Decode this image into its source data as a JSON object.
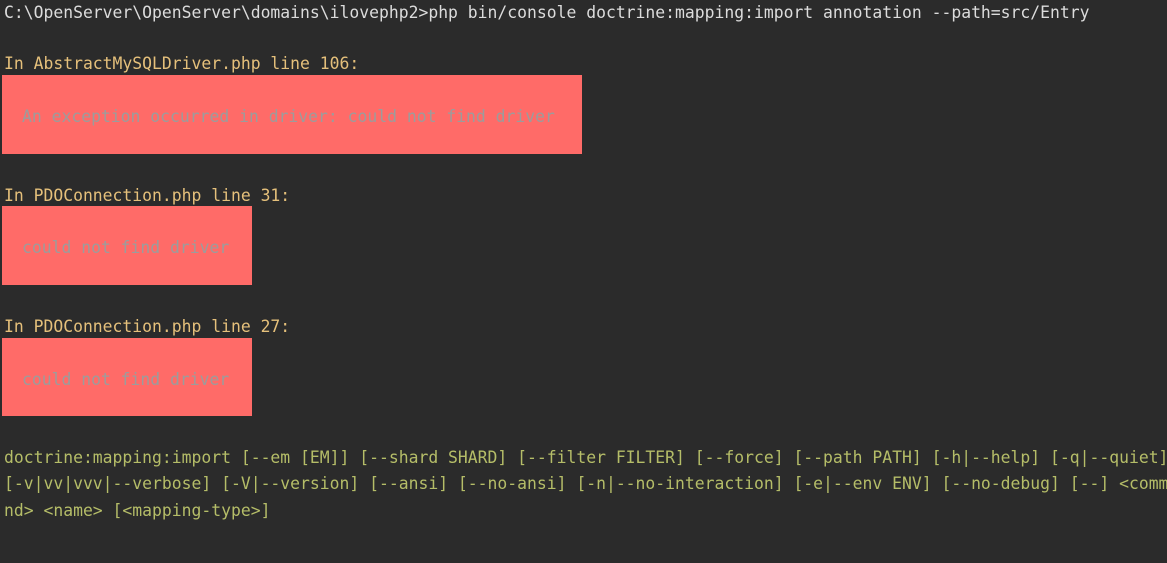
{
  "terminal": {
    "command_line": "C:\\OpenServer\\OpenServer\\domains\\ilovephp2>php bin/console doctrine:mapping:import annotation --path=src/Entry",
    "errors": [
      {
        "location": "In AbstractMySQLDriver.php line 106:",
        "message": "An exception occurred in driver: could not find driver"
      },
      {
        "location": "In PDOConnection.php line 31:",
        "message": "could not find driver"
      },
      {
        "location": "In PDOConnection.php line 27:",
        "message": "could not find driver"
      }
    ],
    "usage_lines": [
      "doctrine:mapping:import [--em [EM]] [--shard SHARD] [--filter FILTER] [--force] [--path PATH] [-h|--help] [-q|--quiet]",
      "[-v|vv|vvv|--verbose] [-V|--version] [--ansi] [--no-ansi] [-n|--no-interaction] [-e|--env ENV] [--no-debug] [--] <comma",
      "nd> <name> [<mapping-type>]"
    ],
    "colors": {
      "background": "#2b2b2b",
      "command_text": "#dcdcdc",
      "location_text": "#e5c07b",
      "error_block": "#ff6b68",
      "error_text": "#9c9c9c",
      "usage_text": "#b5bd68"
    }
  }
}
